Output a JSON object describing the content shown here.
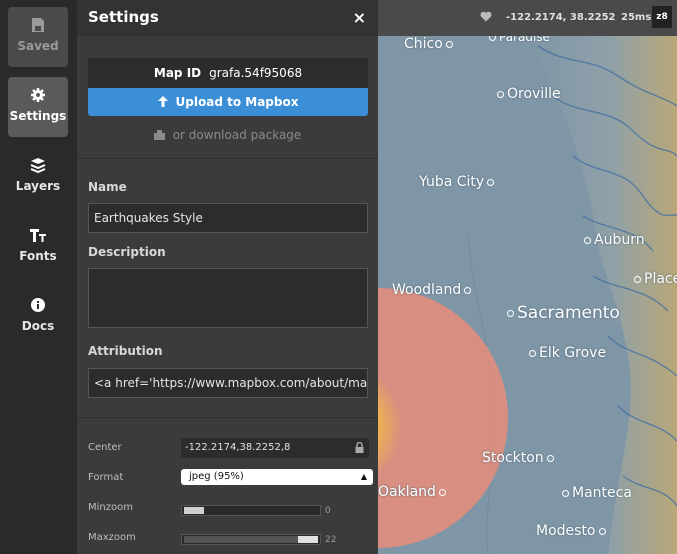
{
  "nav": {
    "items": [
      {
        "label": "Saved",
        "icon": "save-icon"
      },
      {
        "label": "Settings",
        "icon": "gear-icon",
        "active": true
      },
      {
        "label": "Layers",
        "icon": "layers-icon"
      },
      {
        "label": "Fonts",
        "icon": "fonts-icon"
      },
      {
        "label": "Docs",
        "icon": "info-icon"
      }
    ]
  },
  "panel": {
    "title": "Settings",
    "close": "×",
    "map_id_label": "Map ID",
    "map_id_value": "grafa.54f95068",
    "upload_label": "Upload to Mapbox",
    "download_label": "or download package",
    "name_label": "Name",
    "name_value": "Earthquakes Style",
    "description_label": "Description",
    "description_value": "",
    "attribution_label": "Attribution",
    "attribution_value": "<a href='https://www.mapbox.com/about/maps/'",
    "center_label": "Center",
    "center_value": "-122.2174,38.2252,8",
    "format_label": "Format",
    "format_value": "jpeg (95%)",
    "minzoom_label": "Minzoom",
    "minzoom_value": "0",
    "maxzoom_label": "Maxzoom",
    "maxzoom_value": "22"
  },
  "sliders": {
    "minzoom_fraction": 0.0,
    "maxzoom_fraction": 1.0
  },
  "mapbar": {
    "coords": "-122.2174, 38.2252",
    "latency": "25ms",
    "zoom": "z8"
  },
  "map": {
    "cities": [
      "Chico",
      "Paradise",
      "Oroville",
      "Yuba City",
      "Auburn",
      "Placer",
      "Woodland",
      "Sacramento",
      "Elk Grove",
      "Stockton",
      "Oakland",
      "Manteca",
      "Modesto"
    ]
  },
  "colors": {
    "accent": "#3a8fd6",
    "panel": "#3b3b3b",
    "quake": "#ec8c78"
  }
}
